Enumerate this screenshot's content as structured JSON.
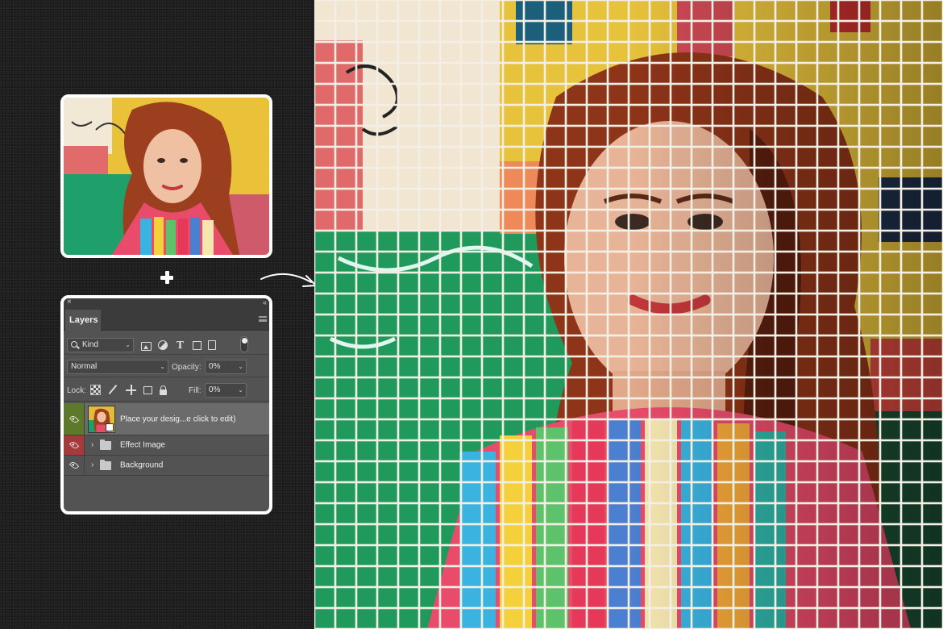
{
  "layers_panel": {
    "close_glyph": "×",
    "collapse_glyph": "‹‹",
    "tab_label": "Layers",
    "filter": {
      "kind_label": "Kind",
      "icons": [
        "image-filter-icon",
        "adjustment-filter-icon",
        "type-filter-icon",
        "shape-filter-icon",
        "smart-object-filter-icon"
      ]
    },
    "blend_mode": "Normal",
    "opacity_label": "Opacity:",
    "opacity_value": "0%",
    "lock_label": "Lock:",
    "lock_icons": [
      "lock-pixels-icon",
      "lock-brush-icon",
      "lock-move-icon",
      "lock-artboard-icon",
      "lock-all-icon"
    ],
    "fill_label": "Fill:",
    "fill_value": "0%",
    "layers": [
      {
        "name": "Place your desig...e click to edit)",
        "type": "smart-object",
        "visible": true,
        "eye_color": "#5d7a2a"
      },
      {
        "name": "Effect Image",
        "type": "group",
        "visible": true,
        "eye_color": "#a53a3a"
      },
      {
        "name": "Background",
        "type": "group",
        "visible": true,
        "eye_color": "#535353"
      }
    ]
  },
  "colors": {
    "background": "#1e1e1e",
    "card_border": "#ffffff",
    "panel_bg": "#535353",
    "panel_header": "#3b3b3b",
    "tile_green": "#1f9a5c",
    "tile_yellow": "#e7c23b",
    "tile_grout": "#f4efe4"
  }
}
